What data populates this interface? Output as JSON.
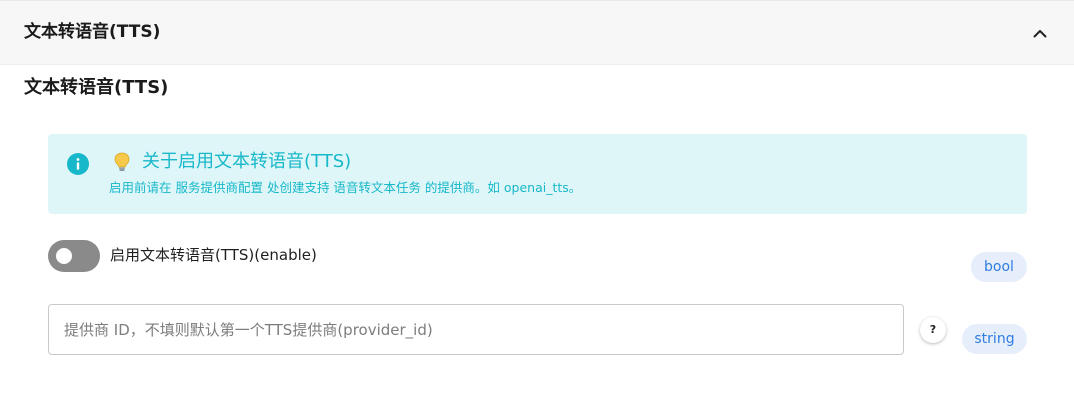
{
  "panel": {
    "title": "文本转语音(TTS)"
  },
  "section": {
    "title": "文本转语音(TTS)"
  },
  "alert": {
    "title": "关于启用文本转语音(TTS)",
    "text": "启用前请在 服务提供商配置 处创建支持 语音转文本任务 的提供商。如 openai_tts。",
    "color": "#17b8c9",
    "background": "#dff6f9",
    "icons": [
      "info-icon",
      "lightbulb-icon"
    ]
  },
  "enable_field": {
    "label": "启用文本转语音(TTS)(enable)",
    "checked": false,
    "type_tag": "bool"
  },
  "provider_field": {
    "placeholder": "提供商 ID，不填则默认第一个TTS提供商(provider_id)",
    "value": "",
    "help_label": "?",
    "type_tag": "string"
  },
  "colors": {
    "accent": "#2f7de1",
    "chip_bg": "#e6eefb",
    "toggle_off": "#8a8a8a"
  }
}
